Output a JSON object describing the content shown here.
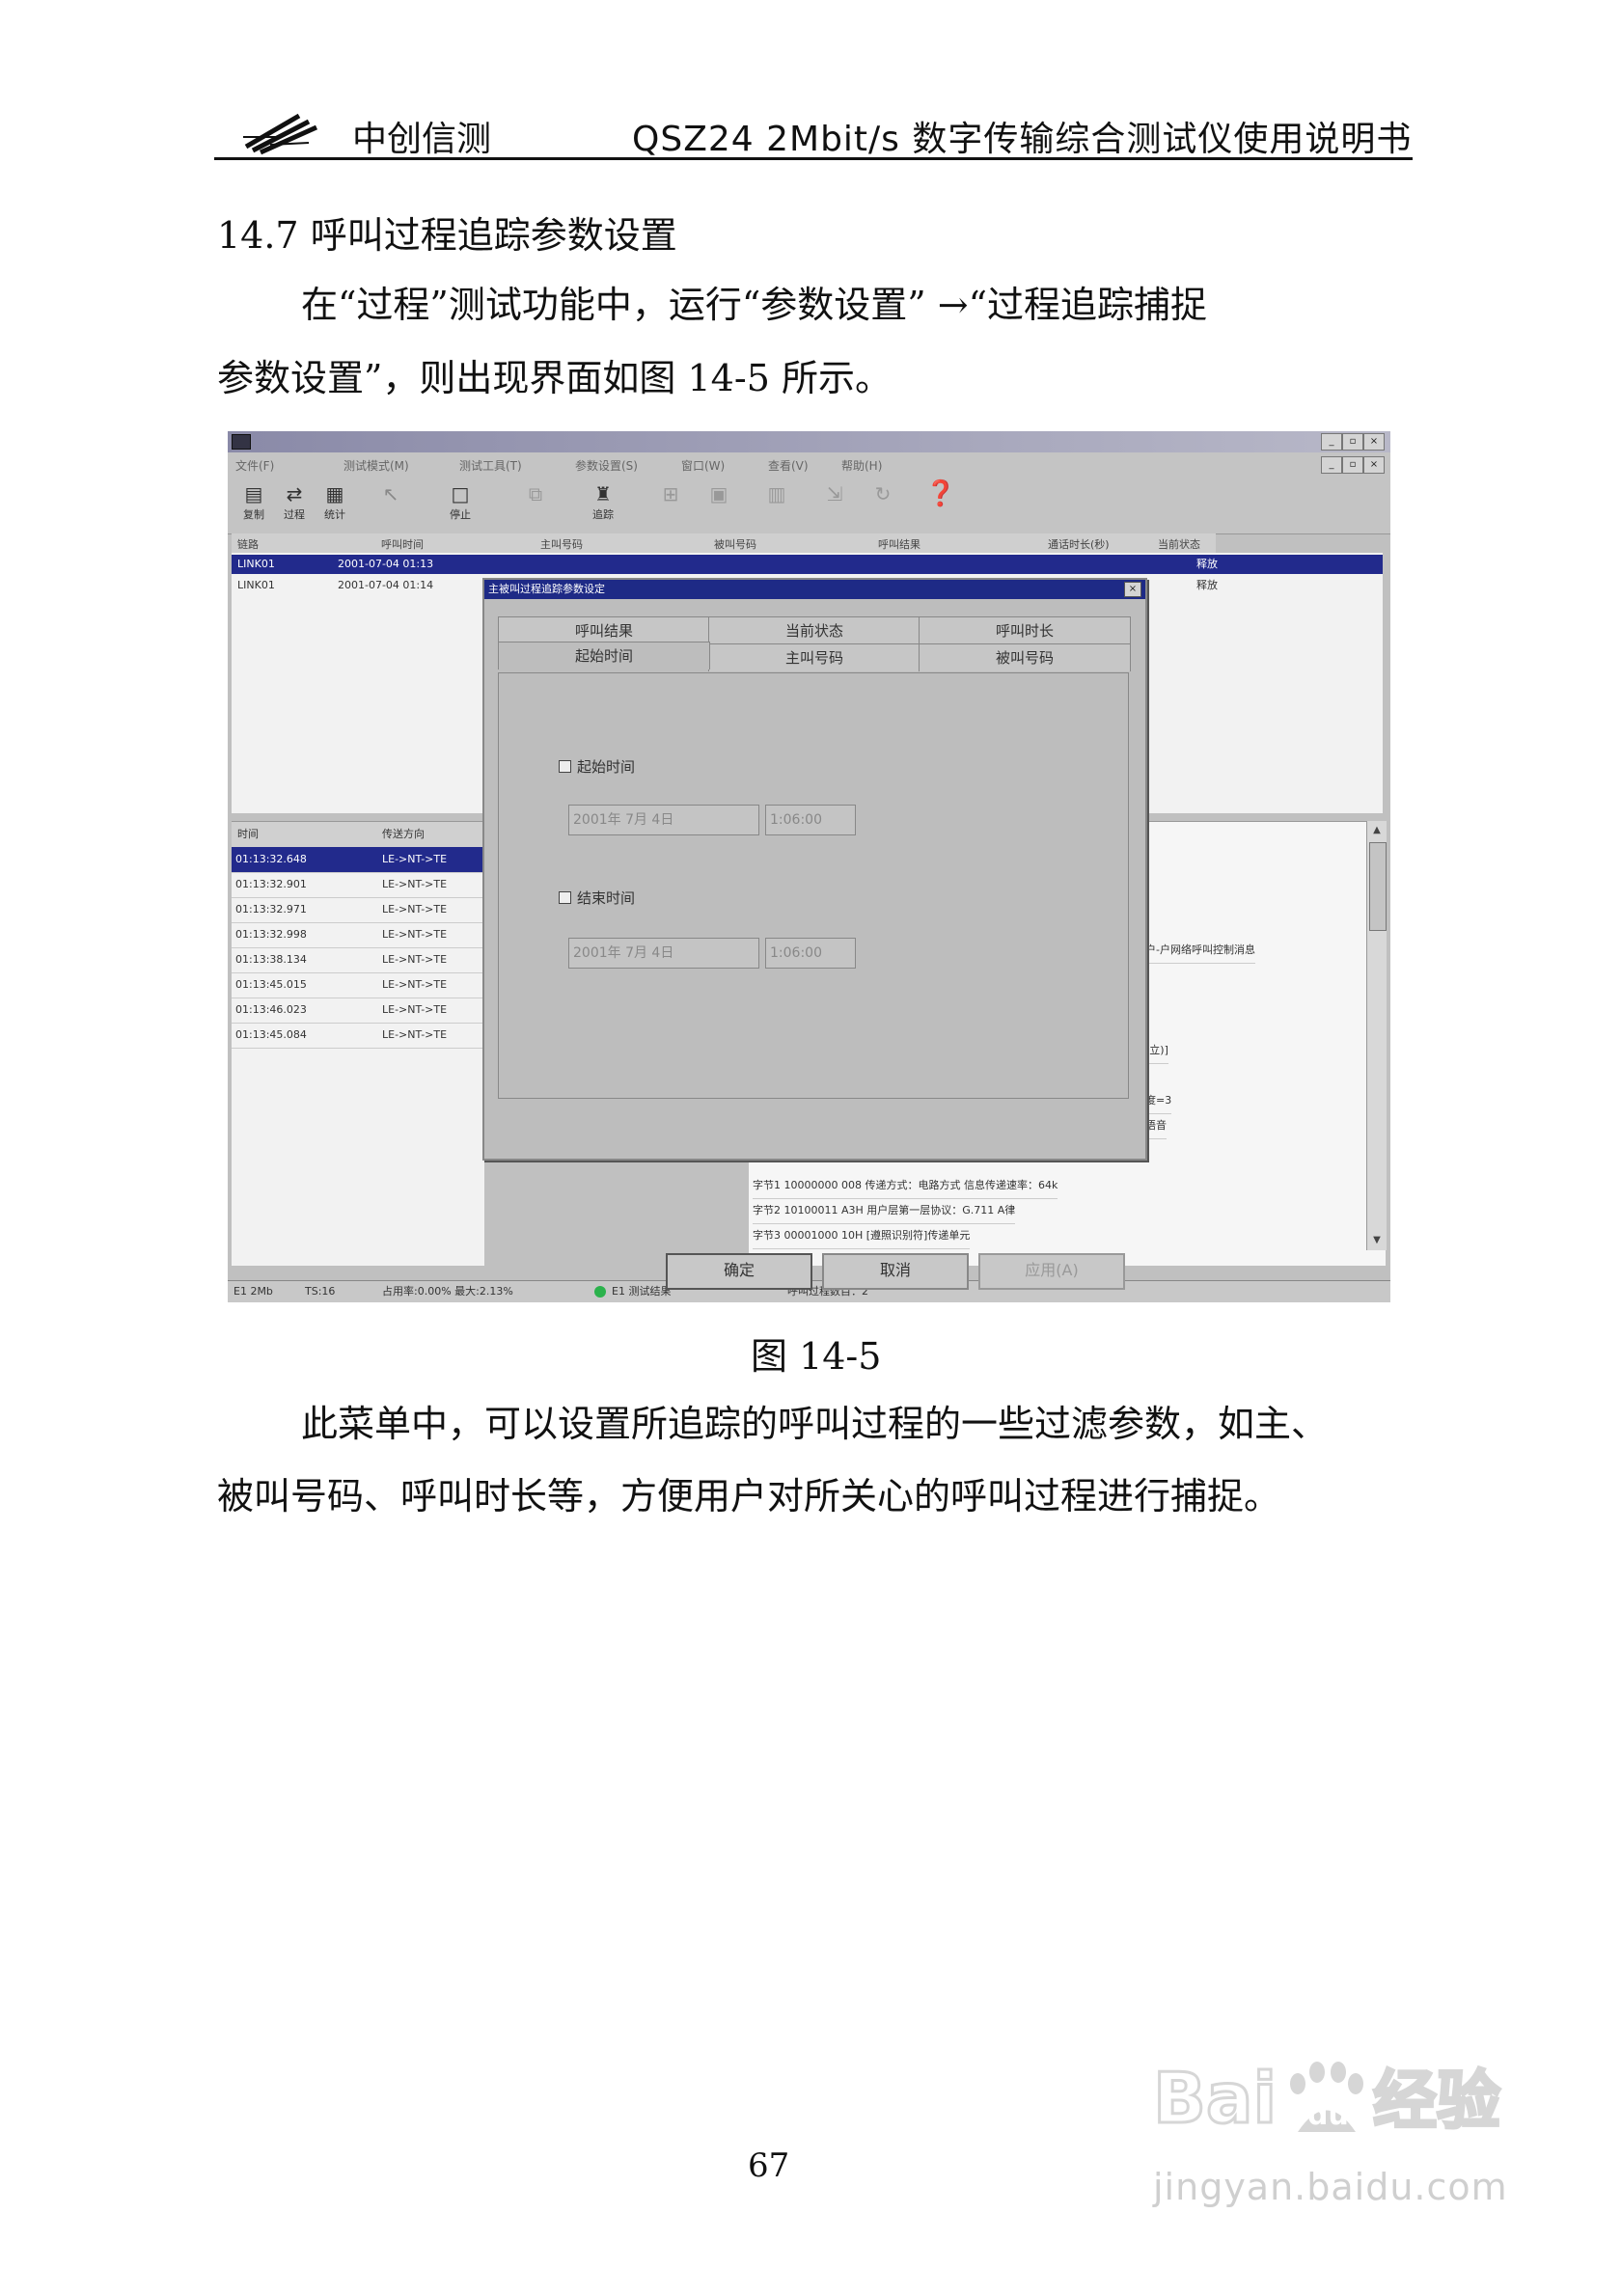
{
  "header": {
    "company": "中创信测",
    "doc_title": "QSZ24  2Mbit/s 数字传输综合测试仪使用说明书"
  },
  "section_title": "14.7  呼叫过程追踪参数设置",
  "para1": {
    "line1": "在“过程”测试功能中，运行“参数设置”  →“过程追踪捕捉",
    "line2": "参数设置”，则出现界面如图 14-5 所示。"
  },
  "figure_caption": "图 14-5",
  "para2": {
    "line1": "此菜单中，可以设置所追踪的呼叫过程的一些过滤参数，如主、",
    "line2": "被叫号码、呼叫时长等，方便用户对所关心的呼叫过程进行捕捉。"
  },
  "page_number": "67",
  "watermark": {
    "url": "jingyan.baidu.com",
    "icon": "baidu-jingyan-logo"
  },
  "screenshot": {
    "menu": [
      "文件(F)",
      "测试模式(M)",
      "测试工具(T)",
      "参数设置(S)",
      "窗口(W)",
      "查看(V)",
      "帮助(H)"
    ],
    "toolbar": [
      "复制",
      "过程",
      "统计",
      "",
      "停止",
      "",
      "追踪",
      "",
      "",
      "",
      "",
      "",
      ""
    ],
    "columns": [
      "链路",
      "呼叫时间",
      "主叫号码",
      "被叫号码",
      "呼叫结果",
      "通话时长(秒)",
      "当前状态"
    ],
    "top_rows": [
      {
        "link": "LINK01",
        "time": "2001-07-04 01:13",
        "status": "释放"
      },
      {
        "link": "LINK01",
        "time": "2001-07-04 01:14",
        "status": "释放"
      }
    ],
    "bottom_columns": [
      "时间",
      "传送方向"
    ],
    "bottom_rows": [
      {
        "time": "01:13:32.648",
        "dir": "LE->NT->TE"
      },
      {
        "time": "01:13:32.901",
        "dir": "LE->NT->TE"
      },
      {
        "time": "01:13:32.971",
        "dir": "LE->NT->TE"
      },
      {
        "time": "01:13:32.998",
        "dir": "LE->NT->TE"
      },
      {
        "time": "01:13:38.134",
        "dir": "LE->NT->TE"
      },
      {
        "time": "01:13:45.015",
        "dir": "LE->NT->TE"
      },
      {
        "time": "01:13:46.023",
        "dir": "LE->NT->TE"
      },
      {
        "time": "01:13:45.084",
        "dir": "LE->NT->TE"
      }
    ],
    "detail_rows": [
      "用户-户网络呼叫控制消息",
      "(建立)]",
      "元",
      "长度=3",
      "：语音",
      "字节1   10000000   008   传递方式：电路方式  信息传递速率：64k",
      "字节2   10100011   A3H   用户层第一层协议：G.711 A律",
      "字节3   00001000   10H   [遵照识别符]传递单元"
    ],
    "status": {
      "s1": "E1 2Mb",
      "s2": "TS:16",
      "s3": "占用率:0.00%  最大:2.13%",
      "s4": "E1 测试结果",
      "s5": "呼叫过程数目：2"
    },
    "dialog": {
      "title": "主被叫过程追踪参数设定",
      "tabs_row1": [
        "呼叫结果",
        "当前状态",
        "呼叫时长"
      ],
      "tabs_row2": [
        "起始时间",
        "主叫号码",
        "被叫号码"
      ],
      "start_label": "起始时间",
      "end_label": "结束时间",
      "start_date": "2001年 7月 4日",
      "start_time": "1:06:00",
      "end_date": "2001年 7月 4日",
      "end_time": "1:06:00",
      "ok": "确定",
      "cancel": "取消",
      "apply": "应用(A)"
    }
  }
}
